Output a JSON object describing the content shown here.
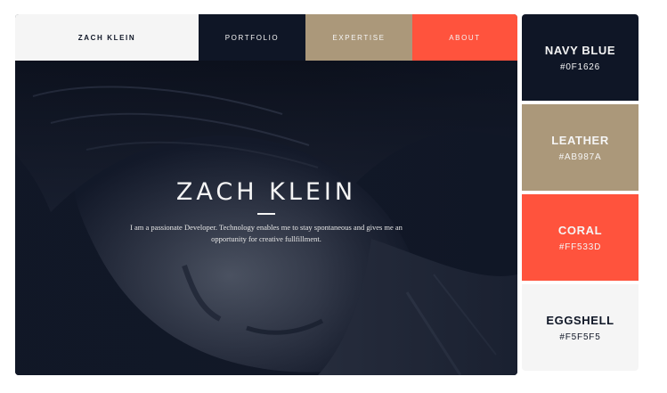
{
  "nav": {
    "brand": "ZACH KLEIN",
    "items": [
      {
        "label": "PORTFOLIO"
      },
      {
        "label": "EXPERTISE"
      },
      {
        "label": "ABOUT"
      }
    ]
  },
  "hero": {
    "title": "ZACH KLEIN",
    "subtitle": "I am a passionate Developer. Technology enables me to stay spontaneous and gives me an opportunity for creative fullfillment."
  },
  "palette": [
    {
      "name": "NAVY BLUE",
      "hex": "#0F1626",
      "color": "#0f1626",
      "text_color": "#f5f5f5"
    },
    {
      "name": "LEATHER",
      "hex": "#AB987A",
      "color": "#ab987a",
      "text_color": "#f5f5f5"
    },
    {
      "name": "CORAL",
      "hex": "#FF533D",
      "color": "#ff533d",
      "text_color": "#f5f5f5"
    },
    {
      "name": "EGGSHELL",
      "hex": "#F5F5F5",
      "color": "#f5f5f5",
      "text_color": "#0f1626"
    }
  ]
}
